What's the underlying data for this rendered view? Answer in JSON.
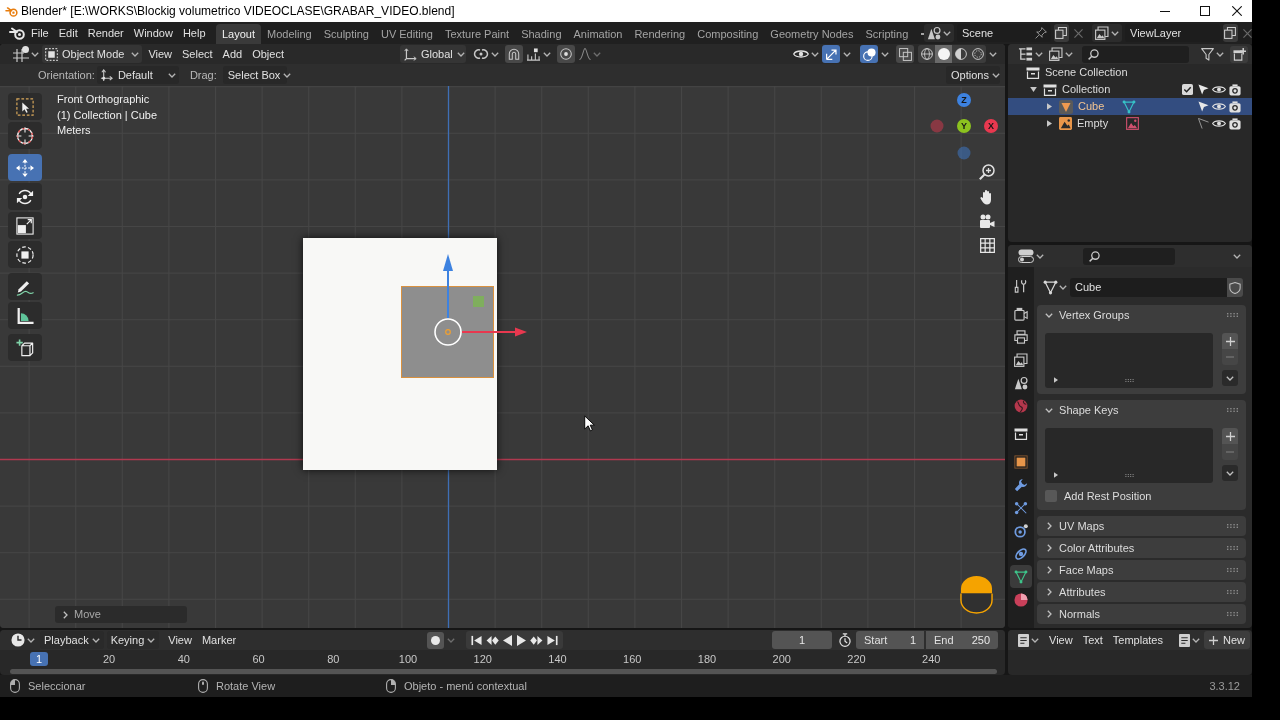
{
  "window": {
    "title": "Blender* [E:\\WORKS\\Blockig volumetrico VIDEOCLASE\\GRABAR_VIDEO.blend]"
  },
  "menu_bar": {
    "menus": [
      "File",
      "Edit",
      "Render",
      "Window",
      "Help"
    ],
    "workspaces": [
      {
        "label": "Layout",
        "selected": true
      },
      {
        "label": "Modeling",
        "selected": false
      },
      {
        "label": "Sculpting",
        "selected": false
      },
      {
        "label": "UV Editing",
        "selected": false
      },
      {
        "label": "Texture Paint",
        "selected": false
      },
      {
        "label": "Shading",
        "selected": false
      },
      {
        "label": "Animation",
        "selected": false
      },
      {
        "label": "Rendering",
        "selected": false
      },
      {
        "label": "Compositing",
        "selected": false
      },
      {
        "label": "Geometry Nodes",
        "selected": false
      },
      {
        "label": "Scripting",
        "selected": false
      }
    ],
    "scene": "Scene",
    "view_layer": "ViewLayer"
  },
  "viewport": {
    "header": {
      "mode": "Object Mode",
      "menus": [
        "View",
        "Select",
        "Add",
        "Object"
      ],
      "orientation": "Global",
      "snap": {
        "on": false
      },
      "proportional_editing": {
        "on": false
      },
      "gizmos": {
        "on": true
      },
      "overlays": {
        "on": true
      },
      "xray": {
        "on": false
      },
      "shading": [
        {
          "kind": "wireframe",
          "selected": false
        },
        {
          "kind": "solid",
          "selected": true
        },
        {
          "kind": "material",
          "selected": false
        },
        {
          "kind": "rendered",
          "selected": false
        }
      ]
    },
    "tool_settings": {
      "orientation_label": "Orientation:",
      "orientation": "Default",
      "drag_label": "Drag:",
      "drag": "Select Box",
      "options": "Options"
    },
    "tools": [
      {
        "kind": "select_box",
        "selected": false
      },
      {
        "kind": "cursor",
        "selected": false
      },
      {
        "kind": "move",
        "selected": true
      },
      {
        "kind": "rotate",
        "selected": false
      },
      {
        "kind": "scale",
        "selected": false
      },
      {
        "kind": "transform",
        "selected": false
      },
      {
        "kind": "annotate",
        "selected": false
      },
      {
        "kind": "measure",
        "selected": false
      },
      {
        "kind": "add_cube",
        "selected": false
      }
    ],
    "info": [
      "Front Orthographic",
      "(1) Collection | Cube",
      "Meters"
    ],
    "navigation_gizmo": [
      {
        "label": "X",
        "color": "#e8384f"
      },
      {
        "label": "Y",
        "color": "#8cc21f"
      },
      {
        "label": "Z",
        "color": "#3d82e0"
      }
    ],
    "last_operator": {
      "label": "Move",
      "expanded": false
    }
  },
  "timeline": {
    "menus": [
      "Playback",
      "Keying",
      "View",
      "Marker"
    ],
    "current_frame": "1",
    "start_label": "Start",
    "start": "1",
    "end_label": "End",
    "end": "250",
    "playhead": "1",
    "ruler": [
      "20",
      "40",
      "60",
      "80",
      "100",
      "120",
      "140",
      "160",
      "180",
      "200",
      "220",
      "240"
    ]
  },
  "status_bar": {
    "hints": [
      {
        "kind": "left",
        "label": "Seleccionar"
      },
      {
        "kind": "middle",
        "label": "Rotate View"
      },
      {
        "kind": "right",
        "label": "Objeto - menú contextual"
      }
    ],
    "version": "3.3.12"
  },
  "outliner": {
    "tree": [
      {
        "label": "Scene Collection",
        "kind": "scene_collection",
        "selected": false,
        "children": [
          {
            "label": "Collection",
            "kind": "collection",
            "selected": false,
            "expanded": true,
            "checked": true,
            "selectable": true,
            "children": [
              {
                "label": "Cube",
                "kind": "mesh",
                "selected": true,
                "expanded": false,
                "selectable": true
              },
              {
                "label": "Empty",
                "kind": "image_empty",
                "selected": false,
                "expanded": false,
                "selectable": false
              }
            ]
          }
        ]
      }
    ]
  },
  "properties": {
    "tabs": [
      {
        "kind": "tool",
        "selected": false
      },
      {
        "kind": "render",
        "selected": false
      },
      {
        "kind": "output",
        "selected": false
      },
      {
        "kind": "view_layer",
        "selected": false
      },
      {
        "kind": "scene",
        "selected": false
      },
      {
        "kind": "world",
        "selected": false
      },
      {
        "kind": "collection",
        "selected": false
      },
      {
        "kind": "object",
        "selected": false
      },
      {
        "kind": "modifiers",
        "selected": false
      },
      {
        "kind": "particles",
        "selected": false
      },
      {
        "kind": "physics",
        "selected": false
      },
      {
        "kind": "constraints",
        "selected": false
      },
      {
        "kind": "data",
        "selected": true
      },
      {
        "kind": "material",
        "selected": false
      }
    ],
    "data_name": "Cube",
    "panels": [
      {
        "label": "Vertex Groups",
        "expanded": true
      },
      {
        "label": "Shape Keys",
        "expanded": true,
        "option": {
          "label": "Add Rest Position",
          "checked": false
        }
      },
      {
        "label": "UV Maps",
        "expanded": false
      },
      {
        "label": "Color Attributes",
        "expanded": false
      },
      {
        "label": "Face Maps",
        "expanded": false
      },
      {
        "label": "Attributes",
        "expanded": false
      },
      {
        "label": "Normals",
        "expanded": false
      }
    ]
  },
  "text_editor": {
    "menus": [
      "View",
      "Text",
      "Templates"
    ],
    "new_button": "New"
  }
}
